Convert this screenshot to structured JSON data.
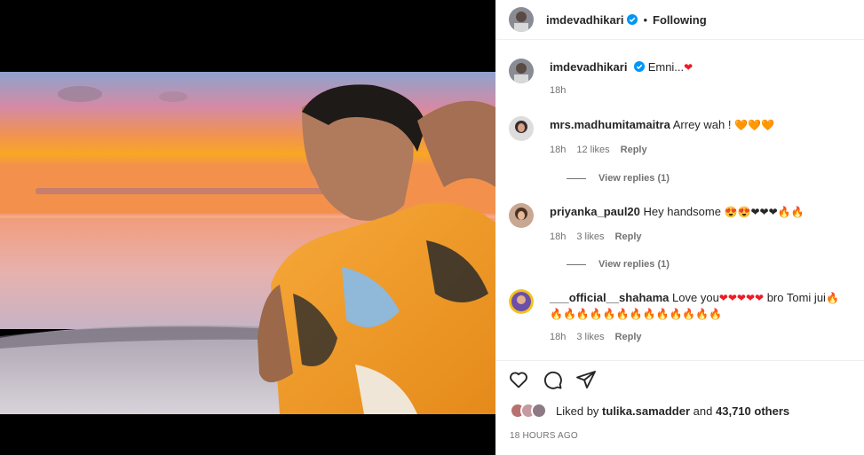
{
  "post": {
    "author": "imdevadhikari",
    "follow_status": "Following",
    "separator": "•"
  },
  "caption": {
    "username": "imdevadhikari",
    "text": "Emni...",
    "emoji": "❤",
    "time": "18h"
  },
  "comments": [
    {
      "username": "mrs.madhumitamaitra",
      "text": "Arrey wah !",
      "emoji": "🧡🧡🧡",
      "time": "18h",
      "likes": "12 likes",
      "reply": "Reply",
      "view_replies": "View replies (1)"
    },
    {
      "username": "priyanka_paul20",
      "text": "Hey handsome",
      "emoji": "😍😍❤❤❤🔥🔥",
      "time": "18h",
      "likes": "3 likes",
      "reply": "Reply",
      "view_replies": "View replies (1)"
    },
    {
      "username": "___official__shahama",
      "text": "Love you",
      "emoji": "❤❤❤❤❤",
      "text2": "bro Tomi jui",
      "emoji2": "🔥",
      "emoji3": "🔥🔥🔥🔥🔥🔥🔥🔥🔥🔥🔥🔥🔥",
      "time": "18h",
      "likes": "3 likes",
      "reply": "Reply"
    }
  ],
  "liked_by": {
    "prefix": "Liked by",
    "user": "tulika.samadder",
    "middle": "and",
    "count": "43,710 others"
  },
  "timestamp": "18 HOURS AGO",
  "icons": [
    "heart-icon",
    "comment-icon",
    "share-icon",
    "verified-badge-icon"
  ],
  "colors": {
    "verified": "#0095f6",
    "heart": "#ed1c24",
    "muted": "#737373"
  }
}
